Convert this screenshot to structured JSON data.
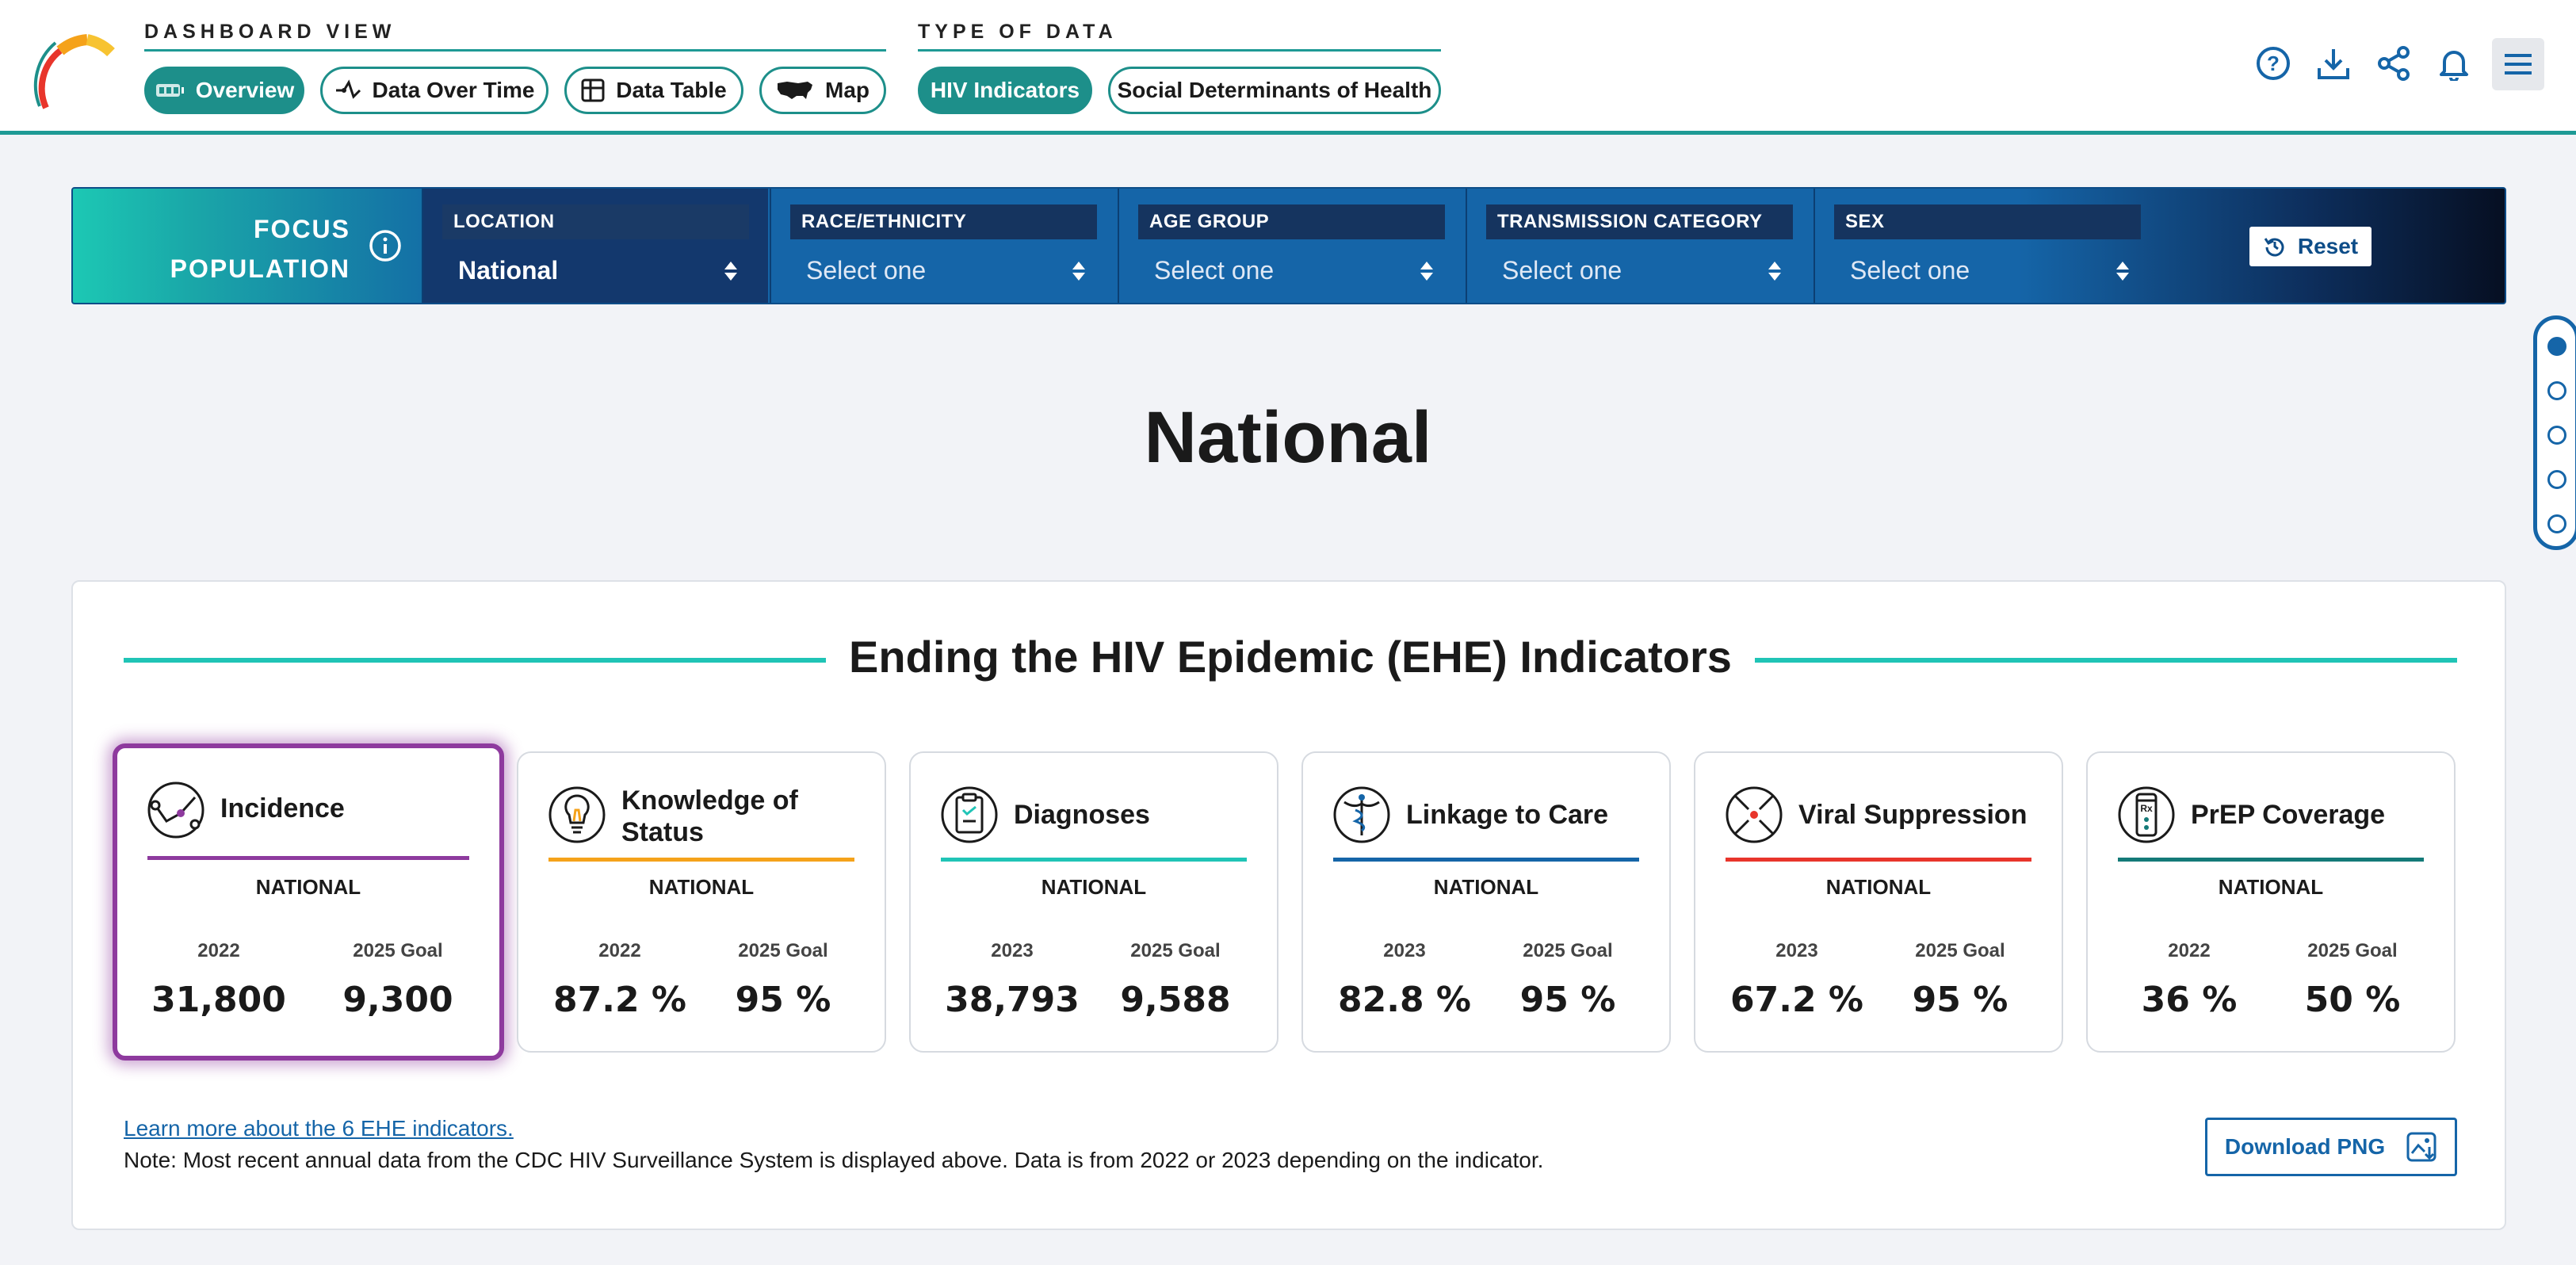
{
  "header": {
    "dashboard_view_label": "DASHBOARD VIEW",
    "type_of_data_label": "TYPE OF DATA",
    "views": [
      {
        "label": "Overview",
        "icon": "gauge-icon",
        "active": true
      },
      {
        "label": "Data Over Time",
        "icon": "trend-icon",
        "active": false
      },
      {
        "label": "Data Table",
        "icon": "table-icon",
        "active": false
      },
      {
        "label": "Map",
        "icon": "usa-map-icon",
        "active": false
      }
    ],
    "data_types": [
      {
        "label": "HIV Indicators",
        "active": true
      },
      {
        "label": "Social Determinants of Health",
        "active": false
      }
    ],
    "actions": [
      "help-icon",
      "download-icon",
      "share-icon",
      "bell-icon",
      "hamburger-menu-icon"
    ]
  },
  "filters": {
    "focus_label_line1": "FOCUS",
    "focus_label_line2": "POPULATION",
    "location": {
      "label": "LOCATION",
      "value": "National"
    },
    "race": {
      "label": "RACE/ETHNICITY",
      "value": "Select one"
    },
    "age": {
      "label": "AGE GROUP",
      "value": "Select one"
    },
    "transmission": {
      "label": "TRANSMISSION CATEGORY",
      "value": "Select one"
    },
    "sex": {
      "label": "SEX",
      "value": "Select one"
    },
    "reset_label": "Reset"
  },
  "page_title": "National",
  "ehe": {
    "title": "Ending the HIV Epidemic (EHE) Indicators",
    "indicators": [
      {
        "name": "Incidence",
        "scope": "NATIONAL",
        "year_label": "2022",
        "year_value": "31,800",
        "goal_label": "2025 Goal",
        "goal_value": "9,300",
        "color": "#8e3a9e",
        "icon": "incidence-icon",
        "selected": true
      },
      {
        "name": "Knowledge of Status",
        "scope": "NATIONAL",
        "year_label": "2022",
        "year_value": "87.2 %",
        "goal_label": "2025 Goal",
        "goal_value": "95 %",
        "color": "#f5a21a",
        "icon": "lightbulb-icon",
        "selected": false
      },
      {
        "name": "Diagnoses",
        "scope": "NATIONAL",
        "year_label": "2023",
        "year_value": "38,793",
        "goal_label": "2025 Goal",
        "goal_value": "9,588",
        "color": "#20c4b6",
        "icon": "clipboard-icon",
        "selected": false
      },
      {
        "name": "Linkage to Care",
        "scope": "NATIONAL",
        "year_label": "2023",
        "year_value": "82.8 %",
        "goal_label": "2025 Goal",
        "goal_value": "95 %",
        "color": "#1565a8",
        "icon": "caduceus-icon",
        "selected": false
      },
      {
        "name": "Viral Suppression",
        "scope": "NATIONAL",
        "year_label": "2023",
        "year_value": "67.2 %",
        "goal_label": "2025 Goal",
        "goal_value": "95 %",
        "color": "#e8352b",
        "icon": "virus-suppression-icon",
        "selected": false
      },
      {
        "name": "PrEP Coverage",
        "scope": "NATIONAL",
        "year_label": "2022",
        "year_value": "36 %",
        "goal_label": "2025 Goal",
        "goal_value": "50 %",
        "color": "#147a78",
        "icon": "pill-bottle-icon",
        "selected": false
      }
    ],
    "learn_more": "Learn more about the 6 EHE indicators.",
    "note": "Note: Most recent annual data from the CDC HIV Surveillance System is displayed above. Data is from 2022 or 2023 depending on the indicator.",
    "download_label": "Download PNG"
  },
  "side_nav": {
    "sections": 5,
    "active_index": 0
  }
}
